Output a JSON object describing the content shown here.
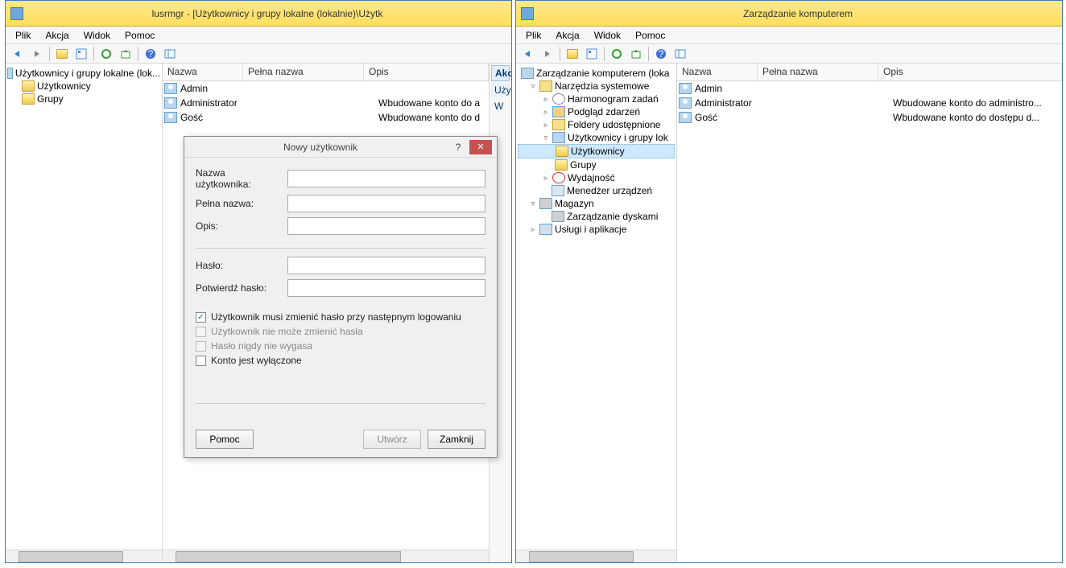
{
  "left_window": {
    "title": "lusrmgr - [Użytkownicy i grupy lokalne (lokalnie)\\Użytk",
    "menus": {
      "file": "Plik",
      "action": "Akcja",
      "view": "Widok",
      "help": "Pomoc"
    },
    "tree": {
      "root": "Użytkownicy i grupy lokalne (lok...",
      "users": "Użytkownicy",
      "groups": "Grupy"
    },
    "columns": {
      "name": "Nazwa",
      "full": "Pełna nazwa",
      "desc": "Opis"
    },
    "rows": [
      {
        "name": "Admin",
        "full": "",
        "desc": ""
      },
      {
        "name": "Administrator",
        "full": "",
        "desc": "Wbudowane konto do a"
      },
      {
        "name": "Gość",
        "full": "",
        "desc": "Wbudowane konto do d"
      }
    ],
    "actions": {
      "header": "Akcje",
      "sub1": "Użytk",
      "sub2": "W"
    }
  },
  "dialog": {
    "title": "Nowy użytkownik",
    "labels": {
      "username": "Nazwa użytkownika:",
      "fullname": "Pełna nazwa:",
      "desc": "Opis:",
      "password": "Hasło:",
      "confirm": "Potwierdź hasło:"
    },
    "checks": {
      "mustchange": "Użytkownik musi zmienić hasło przy następnym logowaniu",
      "cannotchange": "Użytkownik nie może zmienić hasła",
      "neverexpire": "Hasło nigdy nie wygasa",
      "disabled": "Konto jest wyłączone"
    },
    "buttons": {
      "help": "Pomoc",
      "create": "Utwórz",
      "close": "Zamknij"
    }
  },
  "right_window": {
    "title": "Zarządzanie komputerem",
    "menus": {
      "file": "Plik",
      "action": "Akcja",
      "view": "Widok",
      "help": "Pomoc"
    },
    "tree": {
      "root": "Zarządzanie komputerem (loka",
      "systools": "Narzędzia systemowe",
      "sched": "Harmonogram zadań",
      "event": "Podgląd zdarzeń",
      "shared": "Foldery udostępnione",
      "lug": "Użytkownicy i grupy lok",
      "users": "Użytkownicy",
      "groups": "Grupy",
      "perf": "Wydajność",
      "devmgr": "Menedżer urządzeń",
      "storage": "Magazyn",
      "diskmgmt": "Zarządzanie dyskami",
      "services": "Usługi i aplikacje"
    },
    "columns": {
      "name": "Nazwa",
      "full": "Pełna nazwa",
      "desc": "Opis"
    },
    "rows": [
      {
        "name": "Admin",
        "full": "",
        "desc": ""
      },
      {
        "name": "Administrator",
        "full": "",
        "desc": "Wbudowane konto do administro..."
      },
      {
        "name": "Gość",
        "full": "",
        "desc": "Wbudowane konto do dostępu d..."
      }
    ]
  }
}
